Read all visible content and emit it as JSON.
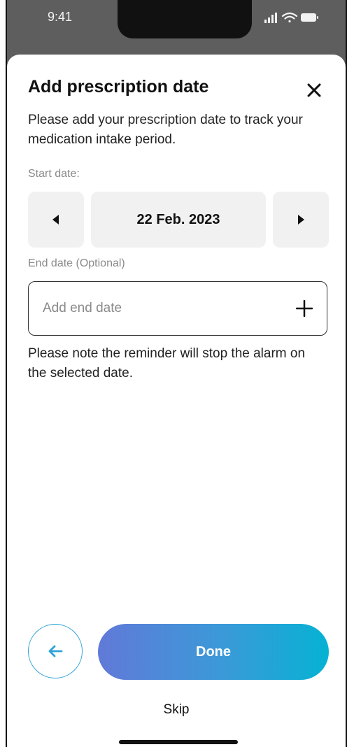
{
  "status_bar": {
    "time": "9:41"
  },
  "sheet": {
    "title": "Add prescription date",
    "subtitle": "Please add your prescription date to track your medication intake period.",
    "start_label": "Start date:",
    "start_date": "22 Feb. 2023",
    "end_label": "End date (Optional)",
    "end_placeholder": "Add end date",
    "note": "Please note the reminder will stop the alarm on the selected date."
  },
  "footer": {
    "done_label": "Done",
    "skip_label": "Skip"
  },
  "icons": {
    "close": "close-icon",
    "prev": "triangle-left-icon",
    "next": "triangle-right-icon",
    "add": "plus-icon",
    "back": "arrow-left-icon"
  },
  "colors": {
    "accent_outline": "#2fa3d8",
    "gradient_start": "#6179d8",
    "gradient_end": "#06b2d4",
    "status_bar_bg": "#5e5e5e"
  }
}
